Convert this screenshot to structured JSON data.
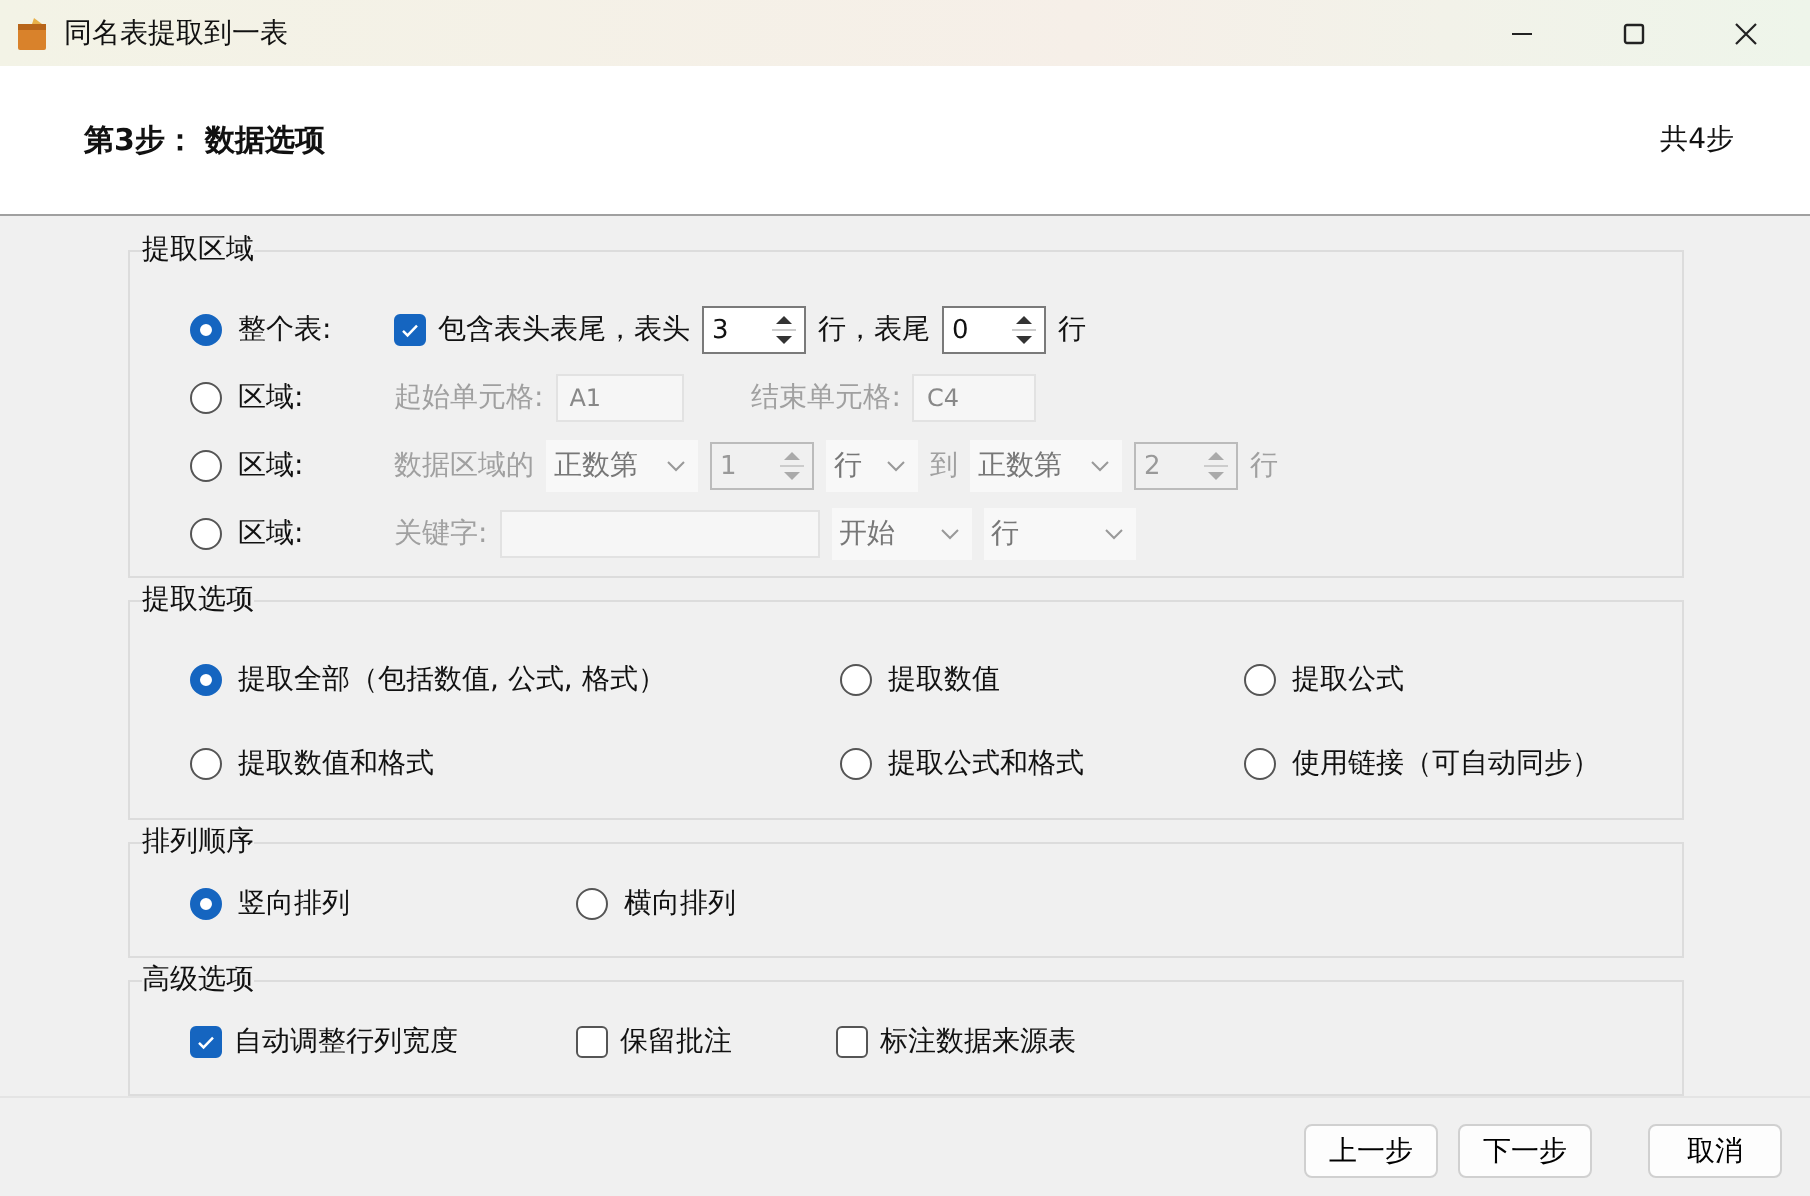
{
  "window": {
    "title": "同名表提取到一表"
  },
  "header": {
    "step": "第3步： 数据选项",
    "total": "共4步"
  },
  "extract_area": {
    "title": "提取区域",
    "rows": [
      {
        "kind": "whole",
        "label": "整个表:",
        "selected": true,
        "include": {
          "label": "包含表头表尾，表头",
          "checked": true
        },
        "head": "3",
        "head_unit": "行，表尾",
        "tail": "0",
        "tail_unit": "行"
      },
      {
        "kind": "cells",
        "label": "区域:",
        "selected": false,
        "start_label": "起始单元格:",
        "start": "A1",
        "end_label": "结束单元格:",
        "end": "C4"
      },
      {
        "kind": "range",
        "label": "区域:",
        "selected": false,
        "prefix": "数据区域的",
        "from_mode": "正数第",
        "from": "1",
        "from_unit": "行",
        "to_label": "到",
        "to_mode": "正数第",
        "to": "2",
        "suffix": "行"
      },
      {
        "kind": "keyword",
        "label": "区域:",
        "selected": false,
        "keyword_label": "关键字:",
        "position": "开始",
        "unit": "行"
      }
    ]
  },
  "extract_options": {
    "title": "提取选项",
    "options": [
      {
        "label": "提取全部（包括数值, 公式, 格式）",
        "selected": true
      },
      {
        "label": "提取数值",
        "selected": false
      },
      {
        "label": "提取公式",
        "selected": false
      },
      {
        "label": "提取数值和格式",
        "selected": false
      },
      {
        "label": "提取公式和格式",
        "selected": false
      },
      {
        "label": "使用链接（可自动同步）",
        "selected": false
      }
    ]
  },
  "order": {
    "title": "排列顺序",
    "options": [
      {
        "label": "竖向排列",
        "selected": true
      },
      {
        "label": "横向排列",
        "selected": false
      }
    ]
  },
  "advanced": {
    "title": "高级选项",
    "options": [
      {
        "label": "自动调整行列宽度",
        "checked": true
      },
      {
        "label": "保留批注",
        "checked": false
      },
      {
        "label": "标注数据来源表",
        "checked": false
      }
    ]
  },
  "buttons": [
    "上一步",
    "下一步",
    "取消"
  ]
}
